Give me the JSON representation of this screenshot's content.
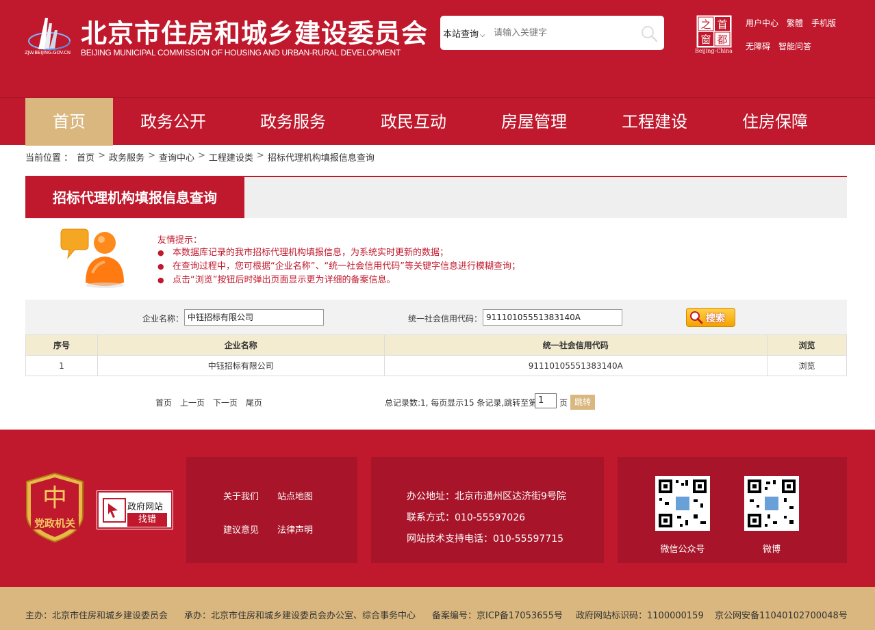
{
  "header": {
    "logo_url_text": "ZJW.BEIJING.GOV.CN",
    "title": "北京市住房和城乡建设委员会",
    "subtitle": "BEIJING MUNICIPAL COMMISSION OF HOUSING AND URBAN-RURAL DEVELOPMENT",
    "search": {
      "scope_label": "本站查询",
      "placeholder": "请输入关键字"
    },
    "capital_logo": {
      "chars": [
        "之",
        "首",
        "窗",
        "都"
      ],
      "en": "Beijing-China"
    },
    "links_row1": [
      "用户中心",
      "繁體",
      "手机版"
    ],
    "links_row2": [
      "无障碍",
      "智能问答"
    ]
  },
  "nav": {
    "items": [
      "首页",
      "政务公开",
      "政务服务",
      "政民互动",
      "房屋管理",
      "工程建设",
      "住房保障"
    ],
    "active_index": 0,
    "active_color": "#d9b77f"
  },
  "breadcrumb": {
    "label": "当前位置 ：",
    "items": [
      "首页",
      "政务服务",
      "查询中心",
      "工程建设类",
      "招标代理机构填报信息查询"
    ],
    "separator": ">"
  },
  "page": {
    "title": "招标代理机构填报信息查询",
    "tips": {
      "heading": "友情提示：",
      "items": [
        "本数据库记录的我市招标代理机构填报信息，为系统实时更新的数据；",
        "在查询过程中，您可根据“企业名称”、“统一社会信用代码”等关键字信息进行模糊查询；",
        "点击“浏览”按钮后时弹出页面显示更为详细的备案信息。"
      ]
    },
    "filters": {
      "company_label": "企业名称：",
      "company_value": "中钰招标有限公司",
      "code_label": "统一社会信用代码：",
      "code_value": "91110105551383140A",
      "search_button": "搜索"
    },
    "table": {
      "headers": [
        "序号",
        "企业名称",
        "统一社会信用代码",
        "浏览"
      ],
      "rows": [
        [
          "1",
          "中钰招标有限公司",
          "91110105551383140A",
          "浏览"
        ]
      ]
    },
    "pager": {
      "first": "首页",
      "prev": "上一页",
      "next": "下一页",
      "last": "尾页",
      "info": "总记录数:1, 每页显示15 条记录,跳转至第",
      "page_value": "1",
      "page_unit": "页",
      "jump": "跳转"
    }
  },
  "footer": {
    "party_badge_text": "党政机关",
    "gov_error": {
      "line1": "政府网站",
      "line2": "找错"
    },
    "links": [
      "关于我们",
      "站点地图",
      "建议意见",
      "法律声明"
    ],
    "contact": [
      "办公地址：北京市通州区达济街9号院",
      "联系方式：010-55597026",
      "网站技术支持电话：010-55597715"
    ],
    "qr": [
      "微信公众号",
      "微博"
    ],
    "bottom": [
      "主办：北京市住房和城乡建设委员会",
      "承办：北京市住房和城乡建设委员会办公室、综合事务中心",
      "备案编号：京ICP备17053655号",
      "政府网站标识码：1100000159",
      "京公网安备11040102700048号"
    ]
  },
  "colors": {
    "brand_red": "#c0192d",
    "dark_red": "#a8152a",
    "gold": "#d9b77f",
    "table_header": "#f3ecd0"
  }
}
